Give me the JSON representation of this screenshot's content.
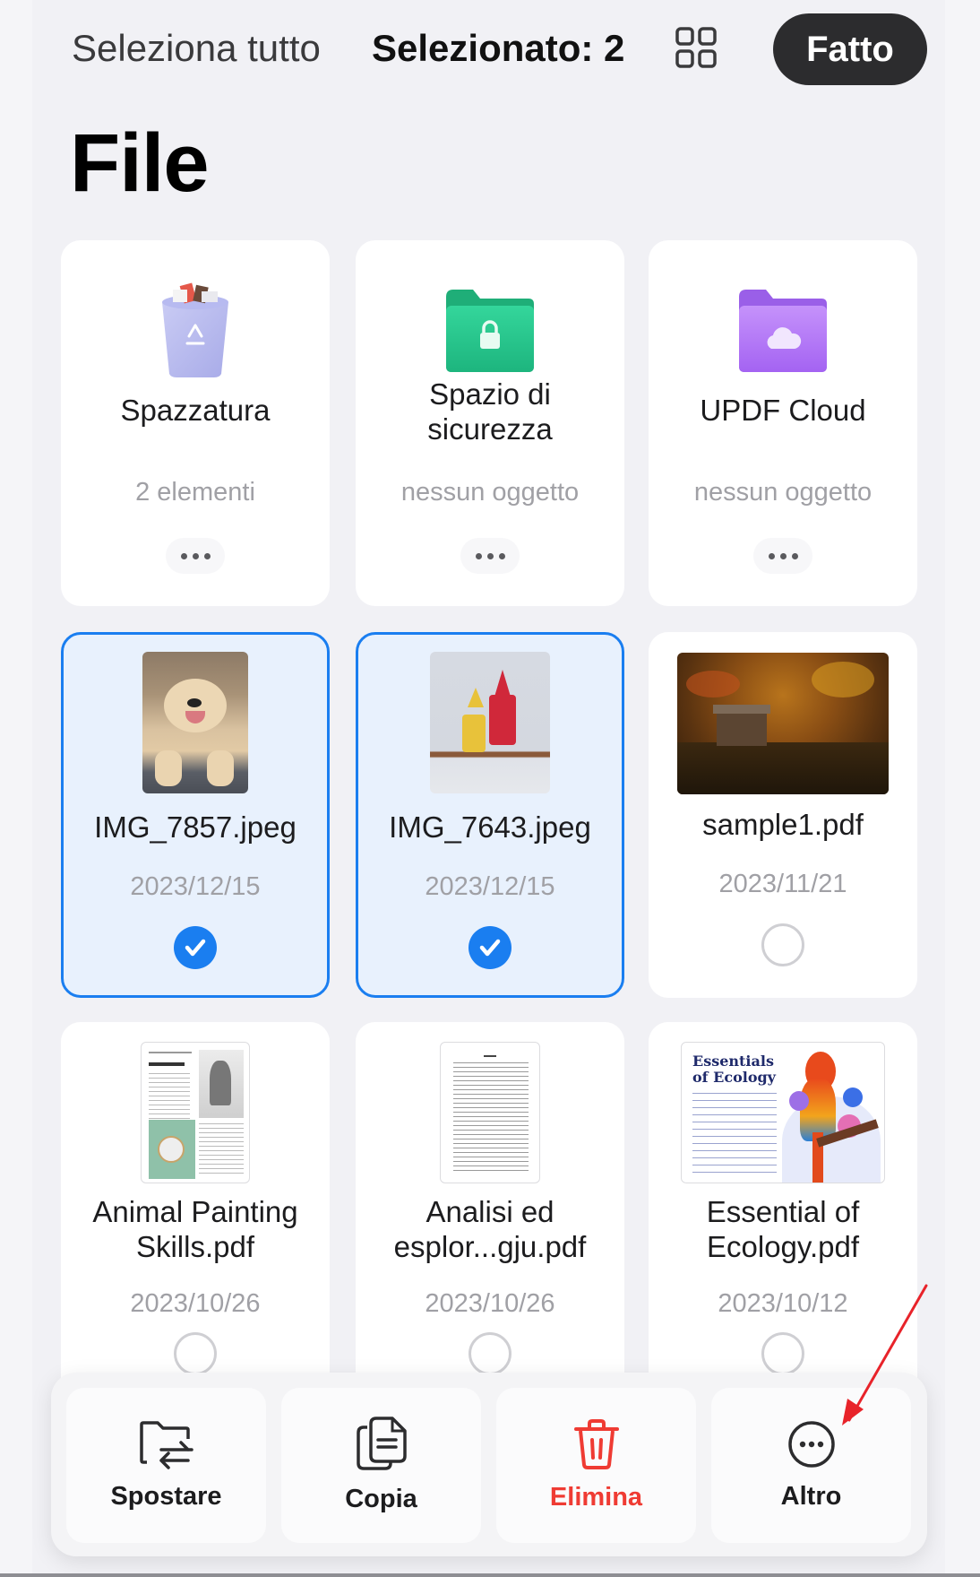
{
  "header": {
    "select_all_label": "Seleziona tutto",
    "selected_count_label": "Selezionato: 2",
    "view_toggle_icon": "grid-view-icon",
    "done_label": "Fatto"
  },
  "page": {
    "title": "File"
  },
  "folders": [
    {
      "name": "Spazzatura",
      "subtitle": "2 elementi",
      "icon": "trash-bin-icon"
    },
    {
      "name": "Spazio di sicurezza",
      "subtitle": "nessun oggetto",
      "icon": "locked-folder-icon",
      "color": "#22c28a"
    },
    {
      "name": "UPDF Cloud",
      "subtitle": "nessun oggetto",
      "icon": "cloud-folder-icon",
      "color": "#a46cf0"
    }
  ],
  "files": [
    {
      "name": "IMG_7857.jpeg",
      "date": "2023/12/15",
      "selected": true,
      "thumbnail": "puppy-photo"
    },
    {
      "name": "IMG_7643.jpeg",
      "date": "2023/12/15",
      "selected": true,
      "thumbnail": "costumed-cats-photo"
    },
    {
      "name": "sample1.pdf",
      "date": "2023/11/21",
      "selected": false,
      "thumbnail": "autumn-lake-cabin"
    },
    {
      "name": "Animal Painting Skills.pdf",
      "date": "2023/10/26",
      "selected": false,
      "thumbnail": "animal-painting-page"
    },
    {
      "name": "Analisi ed esplor...gju.pdf",
      "date": "2023/10/26",
      "selected": false,
      "thumbnail": "table-of-contents-page"
    },
    {
      "name": "Essential of Ecology.pdf",
      "date": "2023/10/12",
      "selected": false,
      "thumbnail": "ecology-parrot-cover",
      "thumb_title": "Essentials of Ecology"
    }
  ],
  "actions": [
    {
      "label": "Spostare",
      "icon": "move-folder-icon"
    },
    {
      "label": "Copia",
      "icon": "copy-document-icon"
    },
    {
      "label": "Elimina",
      "icon": "trash-icon",
      "color": "#ef3b33"
    },
    {
      "label": "Altro",
      "icon": "more-circle-icon"
    }
  ],
  "colors": {
    "accent": "#1a7ef0",
    "danger": "#ef3b33",
    "selected_card_bg": "#e8f1fd",
    "page_bg": "#f1f1f5"
  }
}
